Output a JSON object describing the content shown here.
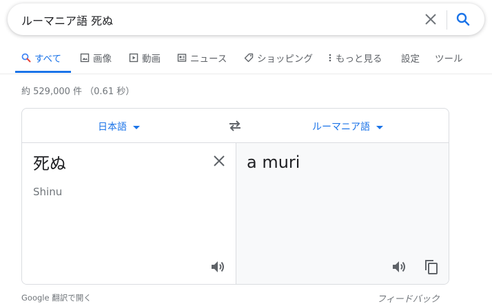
{
  "search": {
    "query": "ルーマニア語 死ぬ"
  },
  "tabs": [
    {
      "label": "すべて",
      "icon": "search-icon"
    },
    {
      "label": "画像",
      "icon": "image-icon"
    },
    {
      "label": "動画",
      "icon": "video-icon"
    },
    {
      "label": "ニュース",
      "icon": "news-icon"
    },
    {
      "label": "ショッピング",
      "icon": "tag-icon"
    },
    {
      "label": "もっと見る",
      "icon": "more-vert-icon"
    },
    {
      "label": "設定"
    },
    {
      "label": "ツール"
    }
  ],
  "result_stats": "約 529,000 件 （0.61 秒）",
  "translate": {
    "source_lang": "日本語",
    "target_lang": "ルーマニア語",
    "source_text": "死ぬ",
    "romanization": "Shinu",
    "translated_text": "a muri"
  },
  "footer": {
    "open_link": "Google 翻訳で開く",
    "feedback": "フィードバック"
  },
  "colors": {
    "accent": "#1a73e8",
    "muted": "#70757a",
    "icon": "#5f6368",
    "border": "#dadce0",
    "target_bg": "#f8f9fa"
  }
}
